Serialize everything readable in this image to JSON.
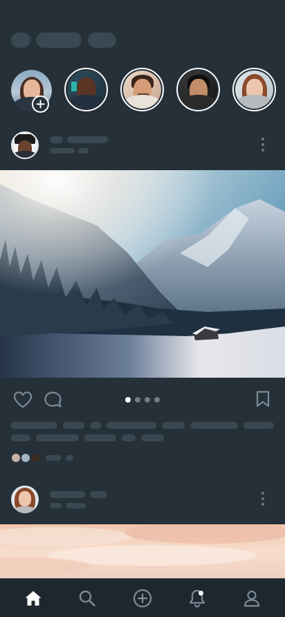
{
  "theme": {
    "background": "#253039",
    "skeleton": "#3a4852",
    "accent": "#ffffff",
    "icon": "#7d8c97"
  },
  "stories": [
    {
      "name": "your-story",
      "has_add_badge": true
    },
    {
      "name": "story-1"
    },
    {
      "name": "story-2"
    },
    {
      "name": "story-3"
    },
    {
      "name": "story-4"
    }
  ],
  "icons": {
    "add": "plus-icon",
    "more": "more-vertical-icon",
    "like": "heart-icon",
    "comment": "comment-bubble-icon",
    "save": "bookmark-icon",
    "home": "home-icon",
    "search": "search-icon",
    "create": "plus-circle-icon",
    "notifications": "bell-icon",
    "profile": "user-icon"
  },
  "carousel": {
    "count": 4,
    "active": 1
  },
  "notifications": {
    "has_unread": true
  }
}
